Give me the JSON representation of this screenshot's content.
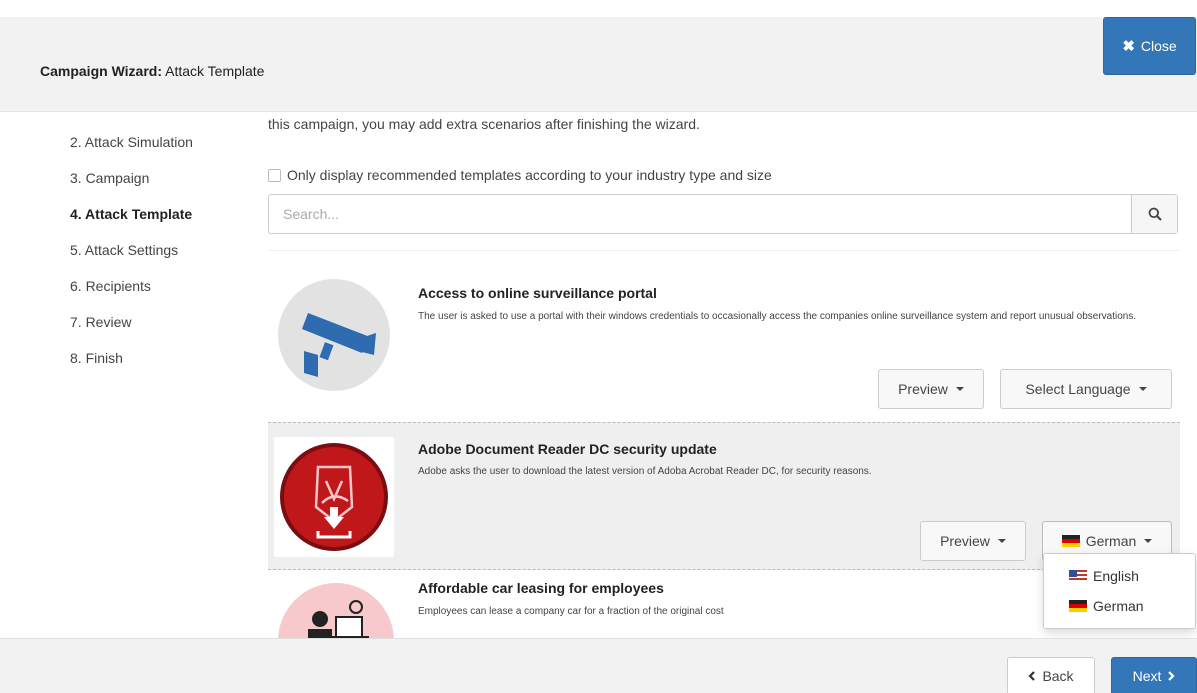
{
  "header": {
    "title_bold": "Campaign Wizard:",
    "title_rest": " Attack Template",
    "close_label": "Close"
  },
  "sidebar": {
    "items": [
      {
        "label": "2. Attack Simulation",
        "active": false
      },
      {
        "label": "3. Campaign",
        "active": false
      },
      {
        "label": "4. Attack Template",
        "active": true
      },
      {
        "label": "5. Attack Settings",
        "active": false
      },
      {
        "label": "6. Recipients",
        "active": false
      },
      {
        "label": "7. Review",
        "active": false
      },
      {
        "label": "8. Finish",
        "active": false
      }
    ]
  },
  "main": {
    "intro_text": "this campaign, you may add extra scenarios after finishing the wizard.",
    "filter_label": "Only display recommended templates according to your industry type and size",
    "search_placeholder": "Search...",
    "templates": [
      {
        "title": "Access to online surveillance portal",
        "description": "The user is asked to use a portal with their windows credentials to occasionally access the companies online surveillance system and report unusual observations.",
        "preview_label": "Preview",
        "language_label": "Select Language"
      },
      {
        "title": "Adobe Document Reader DC security update",
        "description": "Adobe asks the user to download the latest version of Adoba Acrobat Reader DC, for security reasons.",
        "preview_label": "Preview",
        "language_label": "German"
      },
      {
        "title": "Affordable car leasing for employees",
        "description": "Employees can lease a company car for a fraction of the original cost"
      }
    ],
    "language_dropdown": {
      "options": [
        "English",
        "German"
      ]
    }
  },
  "footer": {
    "back_label": "Back",
    "next_label": "Next"
  },
  "colors": {
    "primary": "#3377b8",
    "panel_bg": "#f2f2f2",
    "selected_card_bg": "#efefef",
    "camera_icon": "#2e6bb0",
    "adobe_red": "#c0171b"
  }
}
